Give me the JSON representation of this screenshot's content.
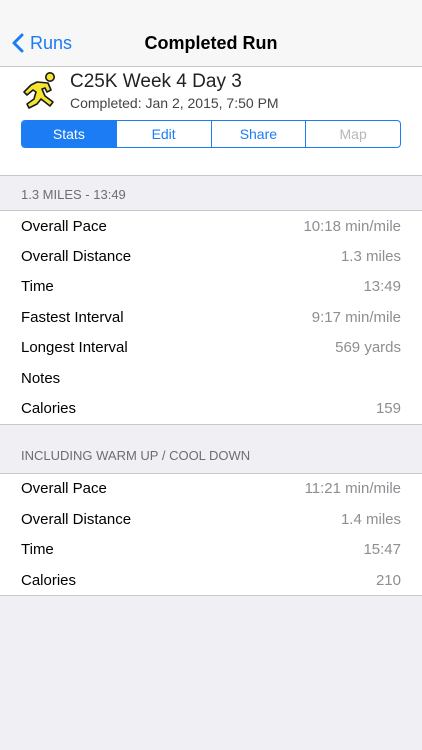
{
  "nav": {
    "back_label": "Runs",
    "title": "Completed Run"
  },
  "workout": {
    "title": "C25K Week 4 Day 3",
    "subtitle": "Completed: Jan 2, 2015, 7:50 PM",
    "icon": "runner-icon"
  },
  "segments": [
    {
      "label": "Stats",
      "state": "selected"
    },
    {
      "label": "Edit",
      "state": "normal"
    },
    {
      "label": "Share",
      "state": "normal"
    },
    {
      "label": "Map",
      "state": "disabled"
    }
  ],
  "sections": [
    {
      "header": "1.3 MILES - 13:49",
      "rows": [
        {
          "label": "Overall Pace",
          "value": "10:18 min/mile"
        },
        {
          "label": "Overall Distance",
          "value": "1.3 miles"
        },
        {
          "label": "Time",
          "value": "13:49"
        },
        {
          "label": "Fastest Interval",
          "value": "9:17 min/mile"
        },
        {
          "label": "Longest Interval",
          "value": "569 yards"
        },
        {
          "label": "Notes",
          "value": ""
        },
        {
          "label": "Calories",
          "value": "159"
        }
      ]
    },
    {
      "header": "INCLUDING WARM UP / COOL DOWN",
      "rows": [
        {
          "label": "Overall Pace",
          "value": "11:21 min/mile"
        },
        {
          "label": "Overall Distance",
          "value": "1.4 miles"
        },
        {
          "label": "Time",
          "value": "15:47"
        },
        {
          "label": "Calories",
          "value": "210"
        }
      ]
    }
  ],
  "colors": {
    "accent": "#1b7cf3",
    "runner_yellow": "#f5e531"
  }
}
